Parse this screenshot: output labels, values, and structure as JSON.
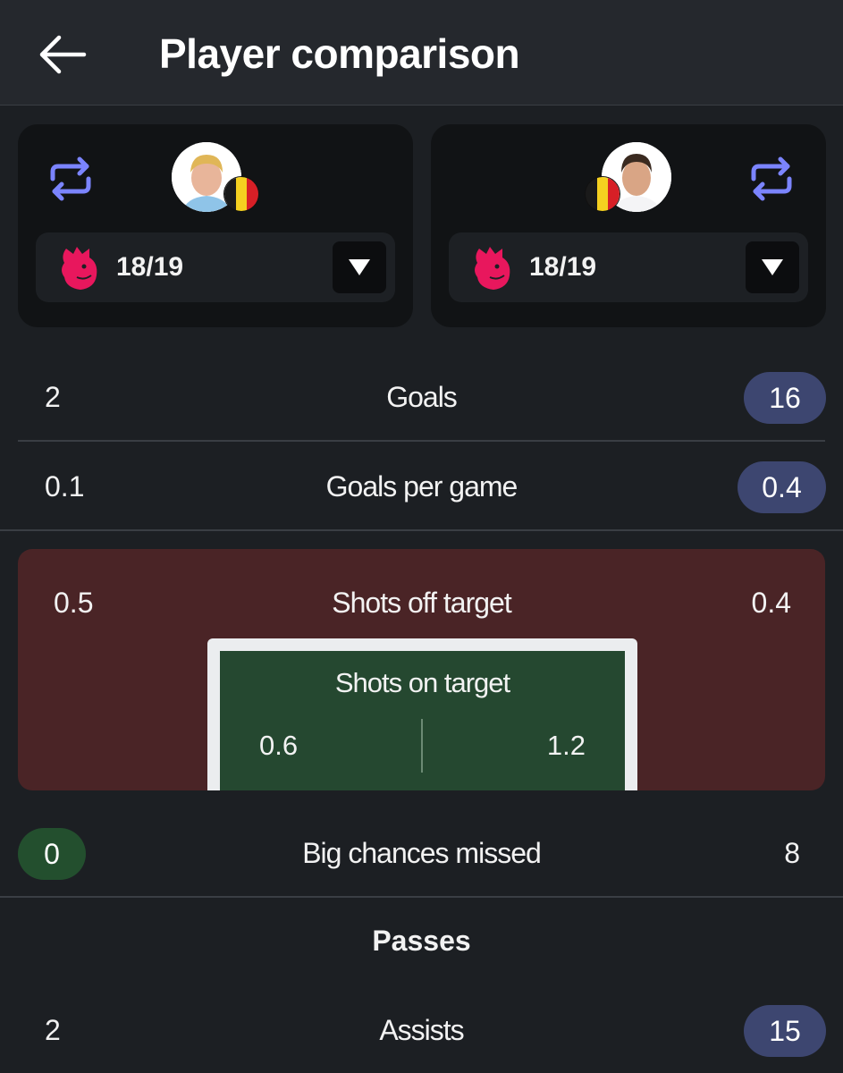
{
  "header": {
    "title": "Player comparison",
    "back_icon": "arrow-left-icon"
  },
  "players": [
    {
      "flag_colors": [
        "#1a1a1a",
        "#f5d020",
        "#d71f26"
      ],
      "season": "18/19",
      "league_icon": "premier-league-lion-icon",
      "swap_icon": "swap-icon"
    },
    {
      "flag_colors": [
        "#1a1a1a",
        "#f5d020",
        "#d71f26"
      ],
      "season": "18/19",
      "league_icon": "premier-league-lion-icon",
      "swap_icon": "swap-icon"
    }
  ],
  "stats": {
    "goals": {
      "label": "Goals",
      "left": "2",
      "right": "16"
    },
    "goals_per_game": {
      "label": "Goals per game",
      "left": "0.1",
      "right": "0.4"
    },
    "shots_off_target": {
      "label": "Shots off target",
      "left": "0.5",
      "right": "0.4"
    },
    "shots_on_target": {
      "label": "Shots on target",
      "left": "0.6",
      "right": "1.2"
    },
    "big_chances_missed": {
      "label": "Big chances missed",
      "left": "0",
      "right": "8"
    }
  },
  "passes": {
    "section_title": "Passes",
    "assists": {
      "label": "Assists",
      "left": "2",
      "right": "15"
    }
  },
  "colors": {
    "accent_swap": "#7b84ff",
    "league_logo": "#e8175d",
    "highlight_blue": "#3d4670",
    "highlight_green": "#234f2e",
    "shots_off_bg": "#4a2426",
    "shots_on_bg": "#254830"
  }
}
